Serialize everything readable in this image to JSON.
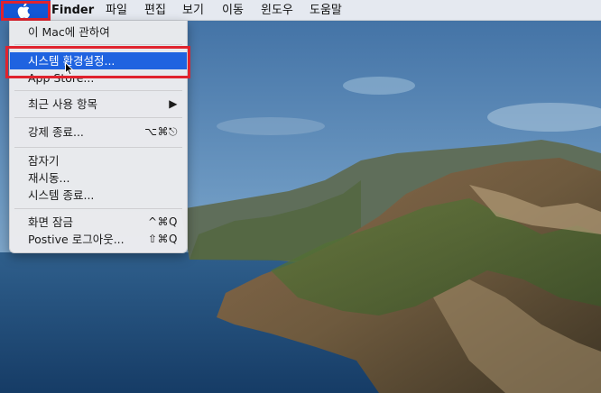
{
  "menubar": {
    "items": [
      "Finder",
      "파일",
      "편집",
      "보기",
      "이동",
      "윈도우",
      "도움말"
    ]
  },
  "apple_menu": {
    "items": [
      {
        "label": "이 Mac에 관하여",
        "shortcut": ""
      },
      {
        "label": "시스템 환경설정...",
        "shortcut": "",
        "selected": true
      },
      {
        "label": "App Store...",
        "shortcut": ""
      },
      {
        "label": "최근 사용 항목",
        "shortcut": "▶"
      },
      {
        "label": "강제 종료...",
        "shortcut": "⌥⌘⎋"
      },
      {
        "label": "잠자기",
        "shortcut": ""
      },
      {
        "label": "재시동...",
        "shortcut": ""
      },
      {
        "label": "시스템 종료...",
        "shortcut": ""
      },
      {
        "label": "화면 잠금",
        "shortcut": "^⌘Q"
      },
      {
        "label": "Postive 로그아웃...",
        "shortcut": "⇧⌘Q"
      }
    ]
  },
  "colors": {
    "highlight": "#1f63e0",
    "annotation": "#e0232e"
  }
}
